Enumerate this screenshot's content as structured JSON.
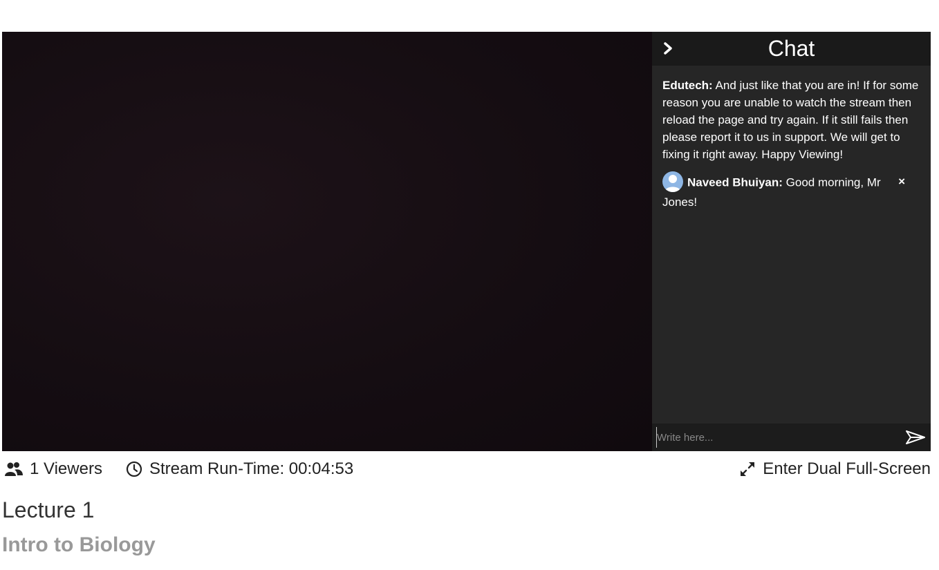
{
  "chat": {
    "title": "Chat",
    "messages": [
      {
        "sender": "Edutech:",
        "text": " And just like that you are in! If for some reason you are unable to watch the stream then reload the page and try again. If it still fails then please report it to us in support. We will get to fixing it right away. Happy Viewing!"
      },
      {
        "sender": "Naveed Bhuiyan:",
        "text": " Good morning, Mr Jones!",
        "close": "×"
      }
    ],
    "input_placeholder": "Write here..."
  },
  "stats": {
    "viewers": "1 Viewers",
    "runtime": "Stream Run-Time: 00:04:53",
    "fullscreen": "Enter Dual Full-Screen"
  },
  "lecture": {
    "title": "Lecture 1",
    "subtitle": "Intro to Biology"
  },
  "colors": {
    "chat_bg": "#262626",
    "chat_header_bg": "#1a1a1a",
    "video_bg": "#150d12",
    "avatar": "#8eb6e4"
  }
}
